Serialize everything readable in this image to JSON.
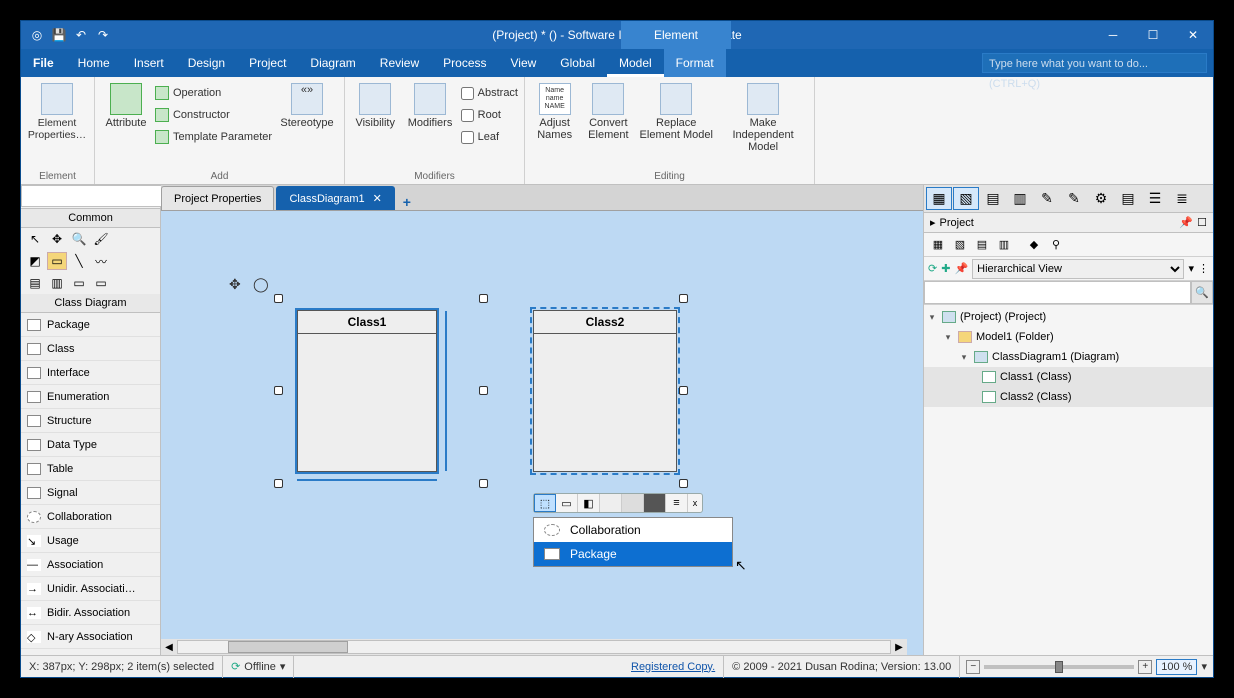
{
  "app": {
    "title": "(Project) * () - Software Ideas Modeler Ultimate",
    "context_tab": "Element",
    "search_placeholder": "Type here what you want to do...  (CTRL+Q)"
  },
  "menus": [
    "File",
    "Home",
    "Insert",
    "Design",
    "Project",
    "Diagram",
    "Review",
    "Process",
    "View",
    "Global",
    "Model",
    "Format"
  ],
  "menu_active": "Model",
  "menu_ctx": "Format",
  "ribbon": {
    "element": {
      "label": "Element",
      "properties": "Element Properties…"
    },
    "add": {
      "label": "Add",
      "attribute": "Attribute",
      "operation": "Operation",
      "constructor": "Constructor",
      "template_param": "Template Parameter",
      "stereotype": "Stereotype"
    },
    "modifiers": {
      "label": "Modifiers",
      "visibility": "Visibility",
      "modifiers": "Modifiers",
      "abstract": "Abstract",
      "root": "Root",
      "leaf": "Leaf"
    },
    "editing": {
      "label": "Editing",
      "adjust": "Adjust Names",
      "convert": "Convert Element",
      "replace": "Replace Element Model",
      "indep": "Make Independent Model"
    }
  },
  "tabs": {
    "t1": "Project Properties",
    "t2": "ClassDiagram1"
  },
  "toolbox": {
    "search_placeholder": "",
    "common": "Common",
    "section": "Class Diagram",
    "items": [
      "Package",
      "Class",
      "Interface",
      "Enumeration",
      "Structure",
      "Data Type",
      "Table",
      "Signal",
      "Collaboration",
      "Usage",
      "Association",
      "Unidir. Associati…",
      "Bidir. Association",
      "N-ary Association"
    ]
  },
  "canvas": {
    "class1": "Class1",
    "class2": "Class2",
    "popup": {
      "i1": "Collaboration",
      "i2": "Package"
    }
  },
  "project_panel": {
    "title": "Project",
    "view": "Hierarchical View",
    "tree": {
      "root": "(Project) (Project)",
      "model": "Model1 (Folder)",
      "diag": "ClassDiagram1 (Diagram)",
      "c1": "Class1 (Class)",
      "c2": "Class2 (Class)"
    }
  },
  "status": {
    "coords": "X: 387px; Y: 298px; 2 item(s) selected",
    "offline": "Offline",
    "reg": "Registered Copy.",
    "copyright": "© 2009 - 2021 Dusan Rodina; Version: 13.00",
    "zoom": "100 %"
  }
}
